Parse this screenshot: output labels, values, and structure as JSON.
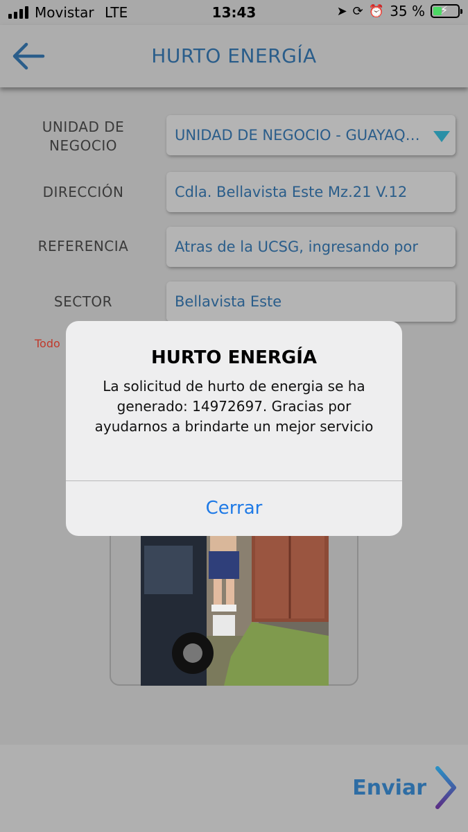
{
  "status_bar": {
    "carrier": "Movistar",
    "network": "LTE",
    "time": "13:43",
    "battery_percent": "35 %",
    "battery_level": 0.35,
    "icons": [
      "location-arrow-icon",
      "orientation-lock-icon",
      "alarm-icon",
      "battery-charging-icon"
    ]
  },
  "header": {
    "title": "HURTO ENERGÍA",
    "back_icon": "arrow-left-icon"
  },
  "form": {
    "fields": [
      {
        "label": "UNIDAD DE NEGOCIO",
        "value": "UNIDAD DE NEGOCIO - GUAYAQUIL"
      },
      {
        "label": "DIRECCIÓN",
        "value": "Cdla. Bellavista Este Mz.21 V.12"
      },
      {
        "label": "REFERENCIA",
        "value": "Atras de la UCSG, ingresando por"
      },
      {
        "label": "SECTOR",
        "value": "Bellavista Este"
      }
    ],
    "required_note": "Todo"
  },
  "bottom_bar": {
    "send_label": "Enviar",
    "send_icon": "chevron-right-icon"
  },
  "alert": {
    "title": "HURTO ENERGÍA",
    "message": "La solicitud de hurto de energia se ha generado: 14972697. Gracias por ayudarnos a brindarte un mejor servicio",
    "button_label": "Cerrar"
  },
  "colors": {
    "accent": "#2a5d8a",
    "alert_button": "#1f7ae6",
    "required": "#c0392b",
    "dropdown_arrow": "#2a8fa6"
  }
}
